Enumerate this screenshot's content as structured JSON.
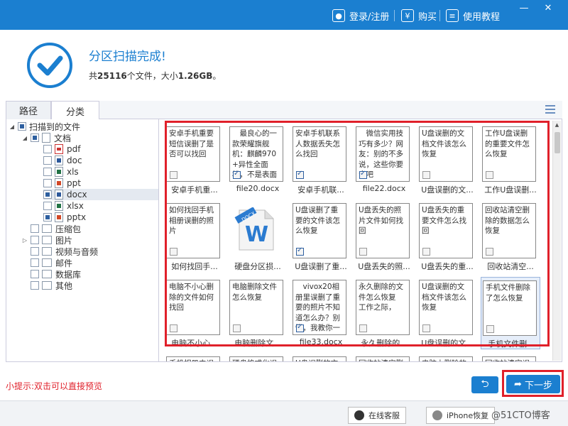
{
  "titlebar": {
    "login": "登录/注册",
    "buy": "购买",
    "tutorial": "使用教程",
    "buy_icon": "¥",
    "minimize": "—",
    "close": "✕"
  },
  "header": {
    "title": "分区扫描完成!",
    "info_prefix": "共",
    "file_count": "25116",
    "info_mid": "个文件，大小",
    "size": "1.26GB",
    "info_suffix": "。"
  },
  "tabs": [
    {
      "label": "路径"
    },
    {
      "label": "分类"
    }
  ],
  "tree": {
    "root": "扫描到的文件",
    "documents": "文档",
    "doc_types": [
      "pdf",
      "doc",
      "xls",
      "ppt",
      "docx",
      "xlsx",
      "pptx"
    ],
    "categories": [
      "压缩包",
      "图片",
      "视频与音频",
      "邮件",
      "数据库",
      "其他"
    ]
  },
  "files": [
    {
      "text": "安卓手机重要短信误删了是否可以找回",
      "name": "安卓手机重..."
    },
    {
      "text": "　最良心的一款荣耀旗舰机：麒麟970+异性全面机，不是表面",
      "name": "file20.docx"
    },
    {
      "text": "安卓手机联系人数据丢失怎么找回",
      "name": "安卓手机联..."
    },
    {
      "text": "　微信实用技巧有多少？网友：别的不多说，这些你要会吧",
      "name": "file22.docx"
    },
    {
      "text": "U盘误删的文档文件该怎么恢复",
      "name": "U盘误删的文..."
    },
    {
      "text": "工作U盘误删的重要文件怎么恢复",
      "name": "工作U盘误删..."
    },
    {
      "text": "如何找回手机相册误删的照片",
      "name": "如何找回手..."
    },
    {
      "text": "",
      "name": "硬盘分区损..."
    },
    {
      "text": "U盘误删了重要的文件该怎么恢复",
      "name": "U盘误删了重..."
    },
    {
      "text": "U盘丢失的照片文件如何找回",
      "name": "U盘丢失的照..."
    },
    {
      "text": "U盘丢失的重要文件怎么找回",
      "name": "U盘丢失的重..."
    },
    {
      "text": "回收站清空删除的数据怎么恢复",
      "name": "回收站清空..."
    },
    {
      "text": "电脑不小心删除的文件如何找回",
      "name": "电脑不小心..."
    },
    {
      "text": "电脑删除文件怎么恢复",
      "name": "电脑删除文..."
    },
    {
      "text": "　vivox20相册里误删了重要的照片不知道怎么办？别慌，我教你一",
      "name": "file33.docx"
    },
    {
      "text": "永久删除的文件怎么恢复　　　工作之际，",
      "name": "永久删除的..."
    },
    {
      "text": "U盘误删的文档文件该怎么恢复",
      "name": "U盘误删的文..."
    },
    {
      "text": "手机文件删除了怎么恢复",
      "name": "手机文件删..."
    },
    {
      "text": "手机相册中误删的照片怎么",
      "name": ""
    },
    {
      "text": "硬盘格式化误删的文件怎么",
      "name": ""
    },
    {
      "text": "U盘误删的文件该怎么恢复",
      "name": ""
    },
    {
      "text": "回收站清空删除的文件怎么",
      "name": ""
    },
    {
      "text": "电脑上删除的文件怎么恢复",
      "name": ""
    },
    {
      "text": "回收站清空误删的文件怎么",
      "name": ""
    }
  ],
  "docx_label": "DOCX",
  "tip": "小提示:双击可以直接预览",
  "buttons": {
    "back": "⮌",
    "next": "下一步",
    "next_icon": "➦"
  },
  "footer": {
    "online_support": "在线客服",
    "iphone_recovery": "iPhone恢复",
    "watermark": "@51CTO博客"
  }
}
